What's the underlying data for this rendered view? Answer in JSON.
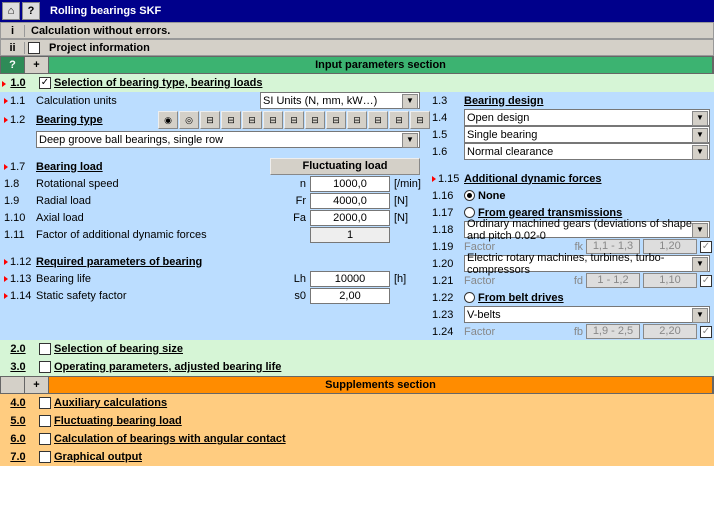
{
  "title": "Rolling bearings SKF",
  "info_i": "Calculation without errors.",
  "info_ii": "Project information",
  "header_input": "Input parameters section",
  "header_supp": "Supplements section",
  "s1": {
    "num": "1.0",
    "label": "Selection of bearing type, bearing loads"
  },
  "s11": {
    "num": "1.1",
    "label": "Calculation units",
    "value": "SI Units (N, mm, kW…)"
  },
  "s12": {
    "num": "1.2",
    "label": "Bearing type",
    "value": "Deep groove ball bearings, single row"
  },
  "s17": {
    "num": "1.7",
    "label": "Bearing load",
    "btn": "Fluctuating load"
  },
  "s18": {
    "num": "1.8",
    "label": "Rotational speed",
    "sym": "n",
    "val": "1000,0",
    "unit": "[/min]"
  },
  "s19": {
    "num": "1.9",
    "label": "Radial load",
    "sym": "Fr",
    "val": "4000,0",
    "unit": "[N]"
  },
  "s110": {
    "num": "1.10",
    "label": "Axial load",
    "sym": "Fa",
    "val": "2000,0",
    "unit": "[N]"
  },
  "s111": {
    "num": "1.11",
    "label": "Factor of additional dynamic forces",
    "val": "1"
  },
  "s112": {
    "num": "1.12",
    "label": "Required parameters of bearing"
  },
  "s113": {
    "num": "1.13",
    "label": "Bearing life",
    "sym": "Lh",
    "val": "10000",
    "unit": "[h]"
  },
  "s114": {
    "num": "1.14",
    "label": "Static safety factor",
    "sym": "s0",
    "val": "2,00"
  },
  "s13": {
    "num": "1.3",
    "label": "Bearing design"
  },
  "s14": {
    "num": "1.4",
    "value": "Open design"
  },
  "s15": {
    "num": "1.5",
    "value": "Single bearing"
  },
  "s16": {
    "num": "1.6",
    "value": "Normal clearance"
  },
  "s115": {
    "num": "1.15",
    "label": "Additional dynamic forces"
  },
  "s116": {
    "num": "1.16",
    "label": "None"
  },
  "s117": {
    "num": "1.17",
    "label": "From geared transmissions"
  },
  "s118": {
    "num": "1.18",
    "value": "Ordinary machined gears (deviations of shape and pitch 0.02-0"
  },
  "s119": {
    "num": "1.19",
    "label": "Factor",
    "sym": "fk",
    "rng": "1,1 - 1,3",
    "val": "1,20"
  },
  "s120": {
    "num": "1.20",
    "value": "Electric rotary machines, turbines, turbo-compressors"
  },
  "s121": {
    "num": "1.21",
    "label": "Factor",
    "sym": "fd",
    "rng": "1 - 1,2",
    "val": "1,10"
  },
  "s122": {
    "num": "1.22",
    "label": "From belt drives"
  },
  "s123": {
    "num": "1.23",
    "value": "V-belts"
  },
  "s124": {
    "num": "1.24",
    "label": "Factor",
    "sym": "fb",
    "rng": "1,9 - 2,5",
    "val": "2,20"
  },
  "s2": {
    "num": "2.0",
    "label": "Selection of bearing size"
  },
  "s3": {
    "num": "3.0",
    "label": "Operating parameters, adjusted bearing life"
  },
  "s4": {
    "num": "4.0",
    "label": "Auxiliary calculations"
  },
  "s5": {
    "num": "5.0",
    "label": "Fluctuating bearing load"
  },
  "s6": {
    "num": "6.0",
    "label": "Calculation of bearings with angular contact"
  },
  "s7": {
    "num": "7.0",
    "label": "Graphical output"
  }
}
